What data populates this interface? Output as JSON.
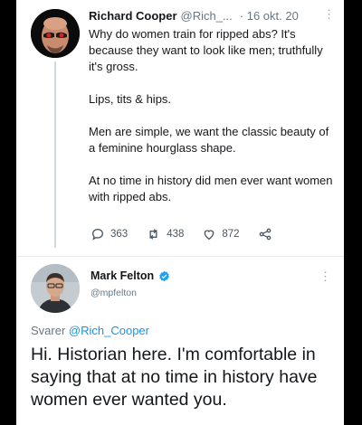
{
  "tweet1": {
    "author_name": "Richard Cooper",
    "author_handle": "@Rich_...",
    "date": "· 16 okt. 20",
    "more": "⋮",
    "paragraphs": [
      "Why do women train for ripped abs? It's because they want to look like men; truthfully it's gross.",
      "Lips, tits & hips.",
      "Men are simple, we want the classic beauty of a feminine hourglass shape.",
      "At no time in history did men ever want women with ripped abs."
    ],
    "actions": {
      "reply_count": "363",
      "retweet_count": "438",
      "like_count": "872"
    }
  },
  "tweet2": {
    "author_name": "Mark Felton",
    "author_handle": "@mpfelton",
    "more": "⋮",
    "reply_prefix": "Svarer",
    "reply_handle": "@Rich_Cooper",
    "text": "Hi. Historian here. I'm comfortable in saying that at no time in history have women ever wanted you."
  },
  "colors": {
    "link": "#1b95e0",
    "verified": "#1da1f2",
    "secondary_text": "#657786"
  },
  "icons": [
    "reply-icon",
    "retweet-icon",
    "like-icon",
    "share-icon",
    "verified-badge-icon",
    "more-icon"
  ]
}
